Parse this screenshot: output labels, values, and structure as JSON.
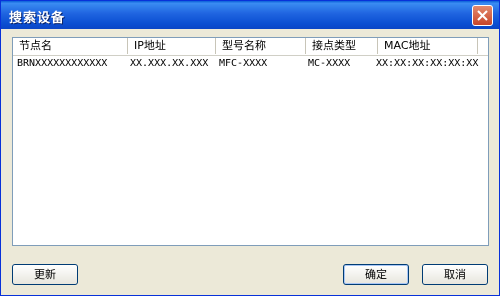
{
  "window": {
    "title": "搜索设备"
  },
  "table": {
    "columns": [
      "节点名",
      "IP地址",
      "型号名称",
      "接点类型",
      "MAC地址"
    ],
    "rows": [
      [
        "BRNXXXXXXXXXXXX",
        "XX.XXX.XX.XXX",
        "MFC-XXXX",
        "MC-XXXX",
        "XX:XX:XX:XX:XX:XX"
      ]
    ]
  },
  "buttons": {
    "refresh": "更新",
    "ok": "确定",
    "cancel": "取消"
  },
  "colors": {
    "titlebar": "#0b55d6",
    "dialog_bg": "#ece9d8",
    "close": "#d4583b"
  },
  "icons": {
    "close": "close-icon"
  }
}
